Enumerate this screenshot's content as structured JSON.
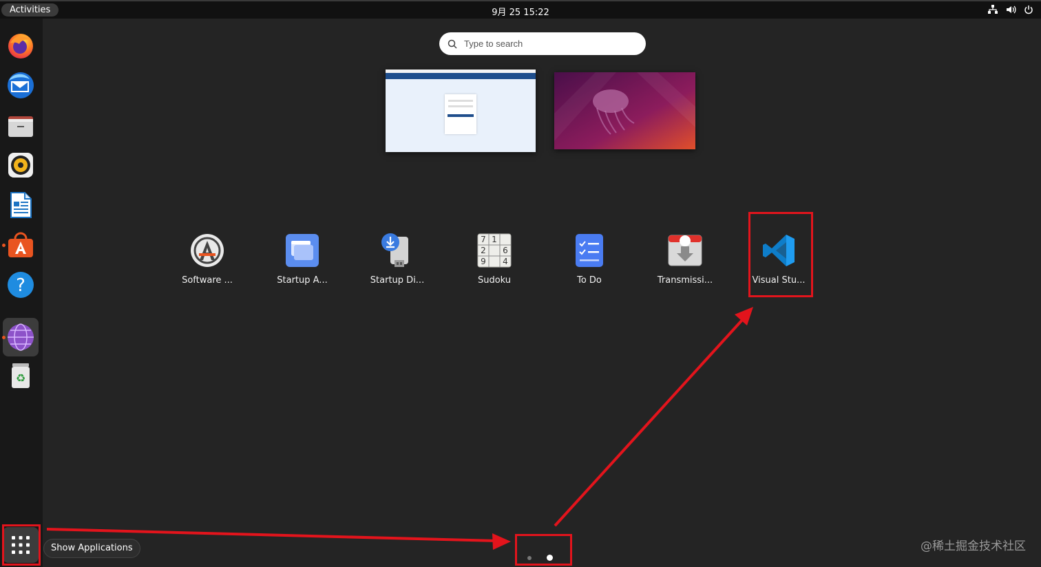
{
  "topbar": {
    "activities_label": "Activities",
    "clock": "9月 25  15:22",
    "tray_icons": [
      "network-icon",
      "volume-icon",
      "power-icon"
    ]
  },
  "dock": {
    "items": [
      {
        "name": "firefox",
        "icon": "firefox-icon"
      },
      {
        "name": "thunderbird",
        "icon": "thunderbird-icon"
      },
      {
        "name": "files",
        "icon": "files-icon"
      },
      {
        "name": "rhythmbox",
        "icon": "rhythmbox-icon"
      },
      {
        "name": "libreoffice-writer",
        "icon": "writer-icon"
      },
      {
        "name": "ubuntu-software",
        "icon": "software-store-icon",
        "running": true
      },
      {
        "name": "help",
        "icon": "help-icon"
      },
      {
        "name": "web-browser",
        "icon": "globe-icon",
        "running": true,
        "active": true
      },
      {
        "name": "trash",
        "icon": "trash-icon"
      }
    ],
    "show_apps_icon": "grid-icon"
  },
  "search": {
    "placeholder": "Type to search"
  },
  "apps": [
    {
      "label": "Software ...",
      "icon": "software-properties-icon"
    },
    {
      "label": "Startup A...",
      "icon": "startup-applications-icon"
    },
    {
      "label": "Startup Di...",
      "icon": "startup-disk-creator-icon"
    },
    {
      "label": "Sudoku",
      "icon": "sudoku-icon"
    },
    {
      "label": "To Do",
      "icon": "todo-icon"
    },
    {
      "label": "Transmissi...",
      "icon": "transmission-icon"
    },
    {
      "label": "Visual Stu...",
      "icon": "vscode-icon"
    }
  ],
  "pagination": {
    "pages": 2,
    "current": 2
  },
  "tooltip": {
    "text": "Show Applications"
  },
  "watermark": "@稀土掘金技术社区",
  "annotation_color": "#e3141c"
}
